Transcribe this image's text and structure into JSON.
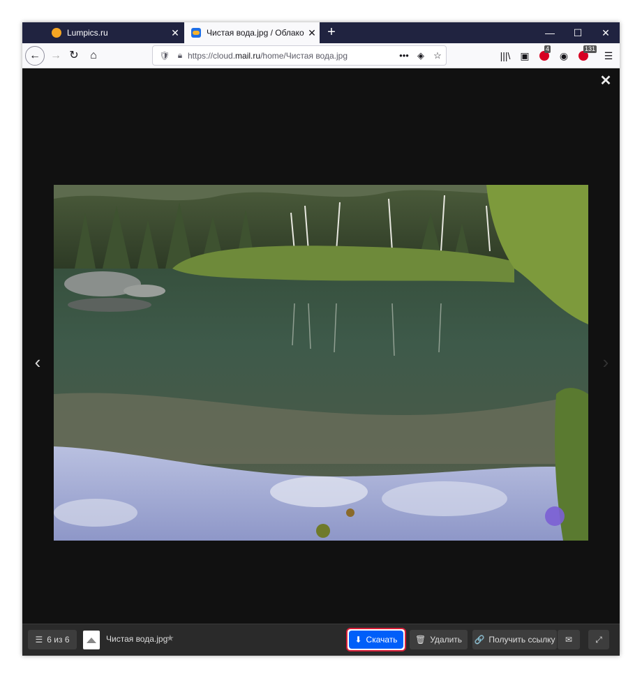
{
  "browser": {
    "tabs": [
      {
        "title": "Lumpics.ru",
        "close": "✕",
        "favicon": "orange-dot-icon"
      },
      {
        "title": "Чистая вода.jpg / Облако Mail.ru",
        "close": "✕",
        "favicon": "mail-cloud-icon"
      }
    ],
    "new_tab": "+",
    "window_controls": {
      "minimize": "—",
      "maximize": "☐",
      "close": "✕"
    },
    "nav": {
      "back": "←",
      "forward": "→",
      "reload": "↻",
      "home": "⌂"
    },
    "url": {
      "prefix": "https://cloud.",
      "host": "mail.ru",
      "path": "/home/Чистая вода.jpg"
    },
    "url_actions": {
      "more": "•••",
      "pocket": "◈",
      "bookmark": "☆"
    },
    "toolbar": {
      "library": "|||\\",
      "sidebar": "▣",
      "abp_count": "4",
      "account": "◉",
      "ext_count": "131",
      "menu": "☰"
    }
  },
  "viewer": {
    "close": "✕",
    "prev": "‹",
    "next": "›",
    "image_alt": "Чистая вода.jpg"
  },
  "bottombar": {
    "counter_glyph": "☰",
    "counter": "6 из 6",
    "file_name": "Чистая вода.jpg",
    "star": "★",
    "download": "Скачать",
    "download_glyph": "⬇",
    "delete": "Удалить",
    "delete_glyph": "🗑",
    "get_link": "Получить ссылку",
    "link_glyph": "🔗",
    "mail_glyph": "✉",
    "fullscreen_glyph": "⤢"
  },
  "colors": {
    "accent": "#005ff9",
    "highlight": "#d41e37",
    "tabbar": "#202340"
  }
}
